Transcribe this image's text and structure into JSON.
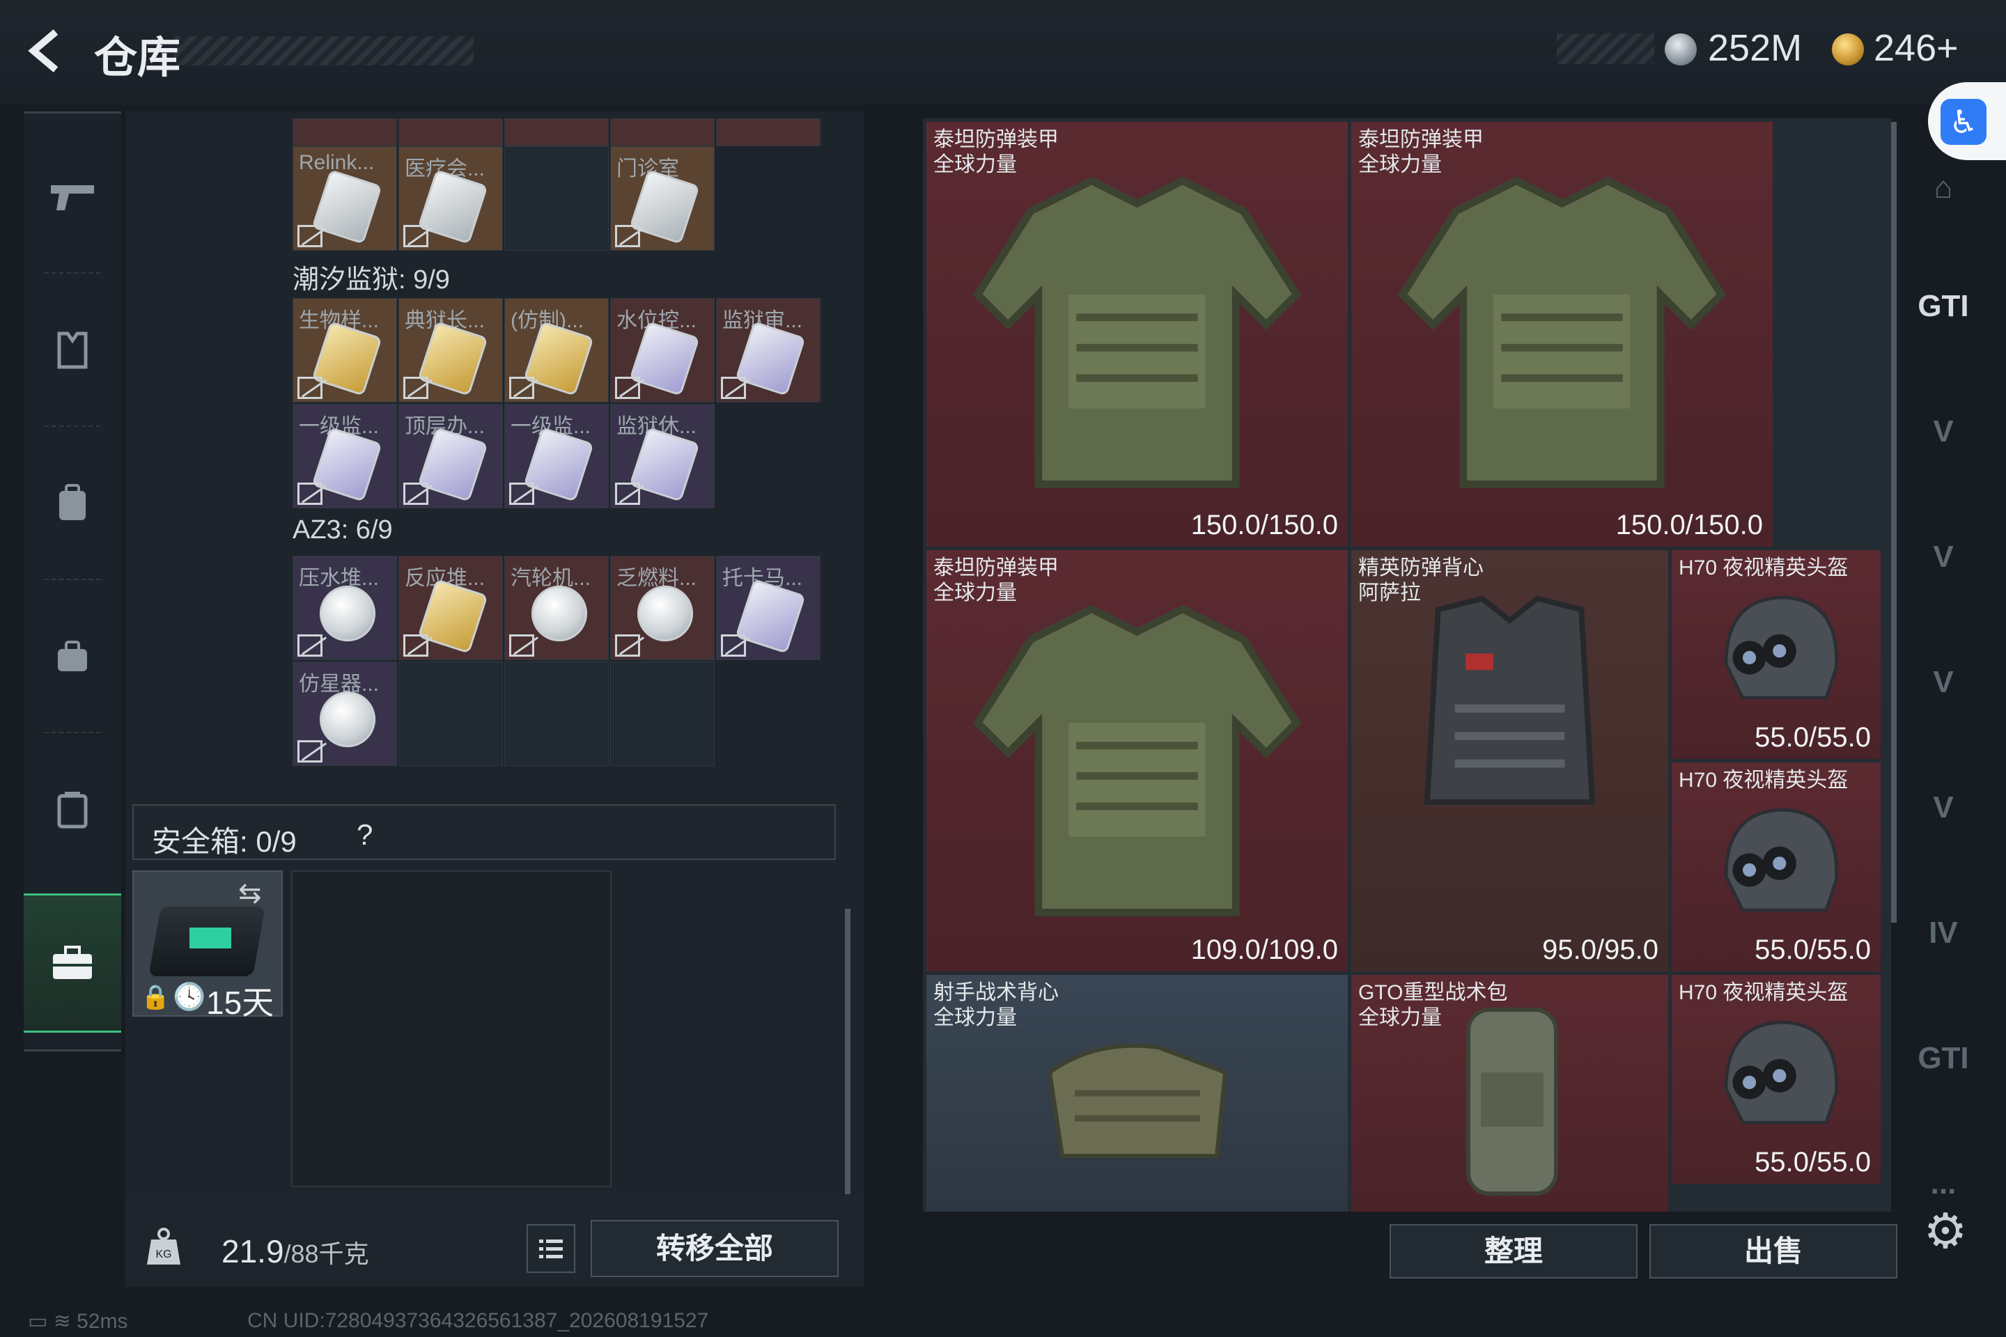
{
  "header": {
    "title": "仓库",
    "currency1": "252M",
    "currency2": "246+"
  },
  "left_panel": {
    "top_partial": [
      "",
      "",
      "",
      "",
      ""
    ],
    "row_a": [
      {
        "label": "Relink...",
        "tone": "orange",
        "card": "white"
      },
      {
        "label": "医疗会...",
        "tone": "orange",
        "card": "white"
      },
      {
        "label": "",
        "tone": "empty",
        "card": ""
      },
      {
        "label": "门诊室",
        "tone": "orange",
        "card": "white"
      }
    ],
    "section1": "潮汐监狱: 9/9",
    "sec1_row1": [
      {
        "label": "生物样...",
        "tone": "orange",
        "card": "gold"
      },
      {
        "label": "典狱长...",
        "tone": "orange",
        "card": "gold"
      },
      {
        "label": "(仿制)...",
        "tone": "orange",
        "card": "gold"
      },
      {
        "label": "水位控...",
        "tone": "red",
        "card": "purple"
      },
      {
        "label": "监狱审...",
        "tone": "red",
        "card": "purple"
      }
    ],
    "sec1_row2": [
      {
        "label": "一级监...",
        "tone": "purple",
        "card": "purple"
      },
      {
        "label": "顶层办...",
        "tone": "purple",
        "card": "purple"
      },
      {
        "label": "一级监...",
        "tone": "purple",
        "card": "purple"
      },
      {
        "label": "监狱休...",
        "tone": "purple",
        "card": "purple"
      }
    ],
    "section2": "AZ3: 6/9",
    "sec2_row1": [
      {
        "label": "压水堆...",
        "tone": "purple",
        "card": "orb"
      },
      {
        "label": "反应堆...",
        "tone": "red",
        "card": "gold"
      },
      {
        "label": "汽轮机...",
        "tone": "red",
        "card": "orb"
      },
      {
        "label": "乏燃料...",
        "tone": "red",
        "card": "orb"
      },
      {
        "label": "托卡马...",
        "tone": "purple",
        "card": "purple"
      }
    ],
    "sec2_row2": [
      {
        "label": "仿星器...",
        "tone": "purple",
        "card": "orb"
      }
    ],
    "safebox": {
      "label": "安全箱: 0/9",
      "help": "?",
      "timer": "15天"
    },
    "weight": {
      "value": "21.9",
      "max": "/88千克"
    },
    "transfer_label": "转移全部"
  },
  "right_panel": {
    "items": [
      {
        "name": "泰坦防弹装甲",
        "sub": "全球力量",
        "durability": "150.0/150.0",
        "bg": "red",
        "icon": "armor-vest"
      },
      {
        "name": "泰坦防弹装甲",
        "sub": "全球力量",
        "durability": "150.0/150.0",
        "bg": "red",
        "icon": "armor-vest"
      },
      {
        "name": "泰坦防弹装甲",
        "sub": "全球力量",
        "durability": "109.0/109.0",
        "bg": "red",
        "icon": "armor-vest"
      },
      {
        "name": "精英防弹背心",
        "sub": "阿萨拉",
        "durability": "95.0/95.0",
        "bg": "brown",
        "icon": "elite-vest"
      },
      {
        "name": "H70 夜视精英头盔",
        "sub": "",
        "durability": "55.0/55.0",
        "bg": "red",
        "icon": "nv-helmet"
      },
      {
        "name": "H70 夜视精英头盔",
        "sub": "",
        "durability": "55.0/55.0",
        "bg": "red",
        "icon": "nv-helmet"
      },
      {
        "name": "射手战术背心",
        "sub": "全球力量",
        "durability": "",
        "bg": "blue",
        "icon": "tactical-vest"
      },
      {
        "name": "GTO重型战术包",
        "sub": "全球力量",
        "durability": "",
        "bg": "red",
        "icon": "backpack"
      },
      {
        "name": "H70 夜视精英头盔",
        "sub": "",
        "durability": "55.0/55.0",
        "bg": "red",
        "icon": "nv-helmet"
      }
    ],
    "sort_label": "整理",
    "sell_label": "出售"
  },
  "right_nav": [
    "GTI",
    "V",
    "V",
    "V",
    "V",
    "IV",
    "GTI",
    "..."
  ],
  "status": {
    "ping": "52ms",
    "uid": "CN UID:7280493736432656138​7_202608191527"
  },
  "colors": {
    "accent_green": "#3cc080",
    "rarity_red": "#5b2a31",
    "rarity_orange": "#5a4330",
    "rarity_purple": "#38334a"
  }
}
